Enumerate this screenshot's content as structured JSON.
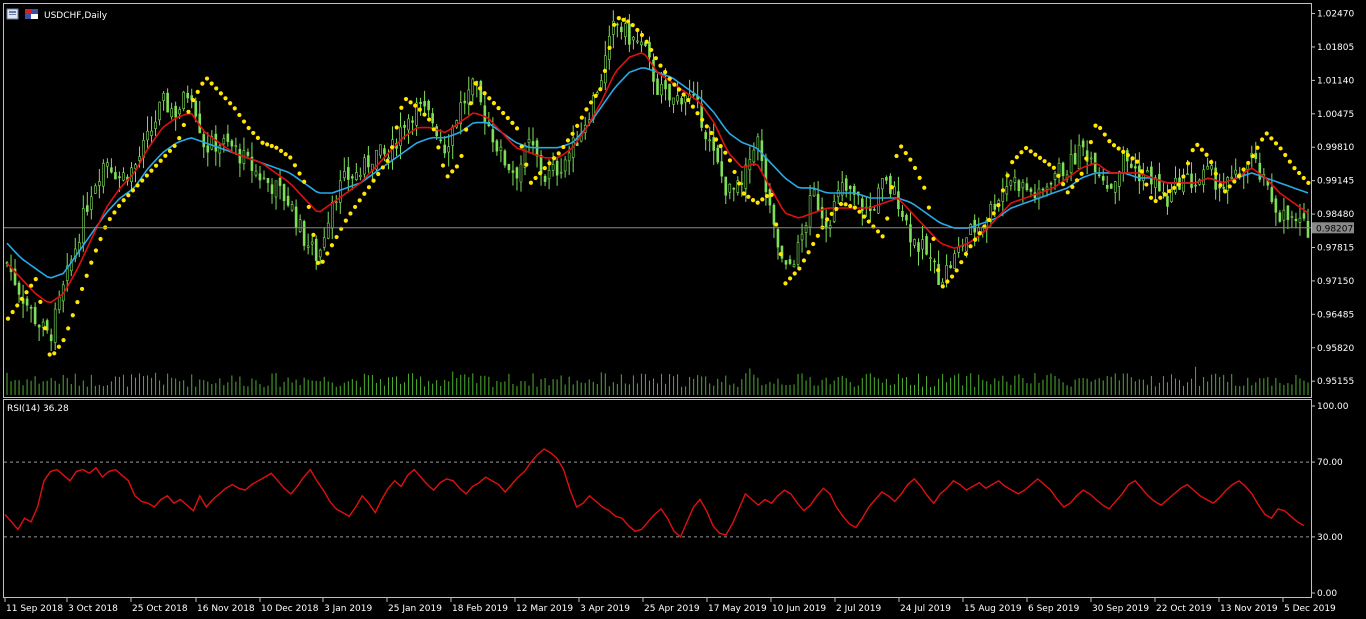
{
  "window": {
    "symbol_title": "USDCHF,Daily",
    "icons": [
      "chart-window-icon",
      "flag-icon"
    ]
  },
  "colors": {
    "background": "#000000",
    "frame": "#c0c0c0",
    "candle_up": "#7fe05a",
    "candle_down": "#7fe05a",
    "volume": "#4caf2f",
    "ma_fast": "#e01010",
    "ma_slow": "#29a9e8",
    "sar": "#ffe600",
    "rsi": "#e01010",
    "current_price_line": "#8a8a8a",
    "price_tag_bg": "#8a8a8a",
    "text": "#ffffff",
    "level_line": "#9a9a9a"
  },
  "chart_data": [
    {
      "type": "candlestick",
      "name": "USDCHF,Daily",
      "y_ticks": [
        "1.02470",
        "1.01805",
        "1.01140",
        "1.00475",
        "0.99810",
        "0.99145",
        "0.98480",
        "0.97815",
        "0.97150",
        "0.96485",
        "0.95820",
        "0.95155"
      ],
      "current_price": "0.98207",
      "ylim": [
        0.9488,
        1.0262
      ],
      "x_labels": [
        "11 Sep 2018",
        "3 Oct 2018",
        "25 Oct 2018",
        "16 Nov 2018",
        "10 Dec 2018",
        "3 Jan 2019",
        "25 Jan 2019",
        "18 Feb 2019",
        "12 Mar 2019",
        "3 Apr 2019",
        "25 Apr 2019",
        "17 May 2019",
        "10 Jun 2019",
        "2 Jul 2019",
        "24 Jul 2019",
        "15 Aug 2019",
        "6 Sep 2019",
        "30 Sep 2019",
        "22 Oct 2019",
        "13 Nov 2019",
        "5 Dec 2019"
      ],
      "close_path": [
        0.975,
        0.969,
        0.964,
        0.96,
        0.97,
        0.98,
        0.99,
        0.996,
        0.992,
        0.994,
        1.0,
        1.007,
        1.005,
        1.01,
        0.998,
        0.999,
        0.998,
        0.995,
        0.992,
        0.99,
        0.987,
        0.98,
        0.976,
        0.988,
        0.992,
        0.993,
        0.997,
        0.996,
        1.003,
        1.006,
        1.004,
        0.998,
        1.006,
        1.01,
        1.003,
        0.996,
        0.993,
        0.999,
        0.992,
        0.994,
        0.998,
        1.004,
        1.012,
        1.023,
        1.02,
        1.018,
        1.01,
        1.007,
        1.009,
        1.005,
        0.996,
        0.989,
        0.99,
        1.001,
        0.984,
        0.973,
        0.978,
        0.989,
        0.983,
        0.99,
        0.988,
        0.985,
        0.991,
        0.988,
        0.98,
        0.977,
        0.972,
        0.976,
        0.981,
        0.983,
        0.988,
        0.992,
        0.99,
        0.988,
        0.993,
        0.994,
        0.998,
        0.995,
        0.99,
        0.996,
        0.993,
        0.992,
        0.987,
        0.992,
        0.991,
        0.993,
        0.99,
        0.992,
        0.996,
        0.99,
        0.985,
        0.983,
        0.982
      ],
      "sma_fast": [
        0.975,
        0.972,
        0.969,
        0.967,
        0.969,
        0.974,
        0.98,
        0.986,
        0.99,
        0.993,
        0.998,
        1.002,
        1.004,
        1.005,
        1.001,
        0.999,
        0.997,
        0.996,
        0.995,
        0.993,
        0.991,
        0.988,
        0.985,
        0.987,
        0.989,
        0.991,
        0.994,
        0.997,
        1.0,
        1.002,
        1.002,
        1.001,
        1.003,
        1.005,
        1.004,
        1.001,
        0.998,
        0.997,
        0.996,
        0.996,
        0.998,
        1.002,
        1.007,
        1.013,
        1.016,
        1.017,
        1.013,
        1.011,
        1.009,
        1.007,
        1.003,
        0.997,
        0.994,
        0.995,
        0.99,
        0.985,
        0.984,
        0.985,
        0.986,
        0.986,
        0.986,
        0.986,
        0.987,
        0.988,
        0.985,
        0.982,
        0.979,
        0.978,
        0.979,
        0.981,
        0.984,
        0.987,
        0.988,
        0.989,
        0.99,
        0.992,
        0.994,
        0.995,
        0.993,
        0.993,
        0.993,
        0.992,
        0.991,
        0.991,
        0.991,
        0.992,
        0.991,
        0.992,
        0.994,
        0.992,
        0.989,
        0.987,
        0.985
      ],
      "sma_slow": [
        0.979,
        0.976,
        0.974,
        0.972,
        0.973,
        0.977,
        0.981,
        0.985,
        0.988,
        0.99,
        0.994,
        0.997,
        0.999,
        1.0,
        0.999,
        0.998,
        0.997,
        0.996,
        0.995,
        0.994,
        0.993,
        0.991,
        0.989,
        0.989,
        0.99,
        0.991,
        0.993,
        0.995,
        0.997,
        0.999,
        1.0,
        1.0,
        1.001,
        1.003,
        1.003,
        1.001,
        0.999,
        0.998,
        0.998,
        0.998,
        0.999,
        1.002,
        1.006,
        1.01,
        1.013,
        1.014,
        1.013,
        1.012,
        1.01,
        1.008,
        1.005,
        1.001,
        0.999,
        0.998,
        0.995,
        0.992,
        0.99,
        0.99,
        0.989,
        0.989,
        0.989,
        0.988,
        0.988,
        0.988,
        0.987,
        0.985,
        0.983,
        0.982,
        0.982,
        0.983,
        0.984,
        0.986,
        0.987,
        0.988,
        0.989,
        0.99,
        0.992,
        0.993,
        0.993,
        0.993,
        0.992,
        0.992,
        0.991,
        0.991,
        0.991,
        0.992,
        0.991,
        0.992,
        0.993,
        0.992,
        0.991,
        0.99,
        0.989
      ],
      "parabolic_sar": [
        0.964,
        0.968,
        0.972,
        0.956,
        0.96,
        0.968,
        0.976,
        0.983,
        0.987,
        0.99,
        0.993,
        0.996,
        0.999,
        1.007,
        1.012,
        1.009,
        1.006,
        1.002,
        0.999,
        0.998,
        0.996,
        0.991,
        0.974,
        0.979,
        0.984,
        0.988,
        0.992,
        0.996,
        1.008,
        1.006,
        1.003,
        0.992,
        0.995,
        1.011,
        1.008,
        1.005,
        1.002,
        0.991,
        0.994,
        0.997,
        1.001,
        1.006,
        1.01,
        1.024,
        1.023,
        1.02,
        1.015,
        1.011,
        1.008,
        1.004,
        1.0,
        0.996,
        0.989,
        0.987,
        0.989,
        0.971,
        0.974,
        0.979,
        0.984,
        0.987,
        0.986,
        0.983,
        0.98,
        0.999,
        0.995,
        0.989,
        0.97,
        0.973,
        0.978,
        0.982,
        0.986,
        0.995,
        0.998,
        0.996,
        0.994,
        0.989,
        0.993,
        1.003,
        0.999,
        0.997,
        0.995,
        0.987,
        0.989,
        0.991,
        0.999,
        0.996,
        0.989,
        0.992,
        0.996,
        1.001,
        0.998,
        0.994,
        0.991
      ]
    },
    {
      "type": "line",
      "name": "RSI(14) 36.28",
      "y_ticks": [
        "100.00",
        "70.00",
        "30.00",
        "0.00"
      ],
      "levels": [
        70,
        30
      ],
      "ylim": [
        0,
        100
      ],
      "values": [
        42,
        38,
        34,
        40,
        38,
        46,
        60,
        65,
        66,
        63,
        60,
        65,
        66,
        64,
        67,
        62,
        65,
        66,
        63,
        60,
        52,
        49,
        48,
        46,
        50,
        52,
        48,
        50,
        47,
        44,
        52,
        46,
        50,
        53,
        56,
        58,
        56,
        55,
        58,
        60,
        62,
        64,
        60,
        56,
        53,
        57,
        62,
        66,
        60,
        55,
        49,
        45,
        43,
        41,
        46,
        52,
        48,
        43,
        50,
        56,
        60,
        57,
        63,
        66,
        62,
        58,
        55,
        59,
        61,
        60,
        56,
        53,
        57,
        59,
        62,
        60,
        58,
        54,
        58,
        62,
        65,
        70,
        74,
        77,
        75,
        72,
        66,
        55,
        46,
        48,
        52,
        49,
        46,
        44,
        41,
        40,
        36,
        33,
        34,
        38,
        42,
        45,
        40,
        33,
        30,
        38,
        46,
        50,
        44,
        36,
        32,
        31,
        37,
        45,
        53,
        50,
        47,
        50,
        48,
        52,
        55,
        53,
        48,
        44,
        47,
        52,
        56,
        53,
        46,
        41,
        37,
        35,
        40,
        46,
        50,
        54,
        52,
        49,
        53,
        58,
        61,
        57,
        52,
        48,
        53,
        56,
        60,
        58,
        55,
        57,
        59,
        56,
        58,
        60,
        57,
        55,
        53,
        55,
        58,
        61,
        58,
        55,
        50,
        46,
        48,
        52,
        55,
        53,
        50,
        47,
        45,
        49,
        53,
        58,
        60,
        56,
        52,
        49,
        47,
        50,
        53,
        56,
        58,
        55,
        52,
        50,
        48,
        51,
        55,
        58,
        60,
        57,
        53,
        47,
        42,
        40,
        45,
        44,
        41,
        38,
        36
      ]
    }
  ]
}
